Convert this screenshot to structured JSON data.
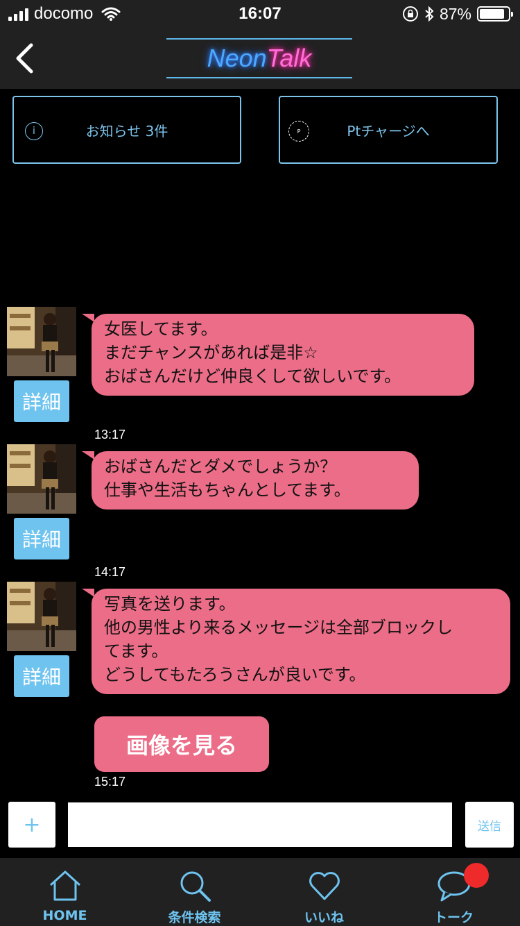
{
  "status_bar": {
    "carrier": "docomo",
    "time": "16:07",
    "battery": "87%",
    "battery_level": 0.87
  },
  "nav": {
    "logo_part1": "Neon",
    "logo_part2": "Talk"
  },
  "info": {
    "notices_label": "お知らせ 3件",
    "charge_label": "Ptチャージへ",
    "charge_icon": "P"
  },
  "messages": [
    {
      "lines": [
        "女医してます。",
        "まだチャンスがあれば是非☆",
        "おばさんだけど仲良くして欲しいです。"
      ],
      "time": "13:17",
      "detail_label": "詳細"
    },
    {
      "lines": [
        "おばさんだとダメでしょうか？",
        "仕事や生活もちゃんとしてます。"
      ],
      "time": "14:17",
      "detail_label": "詳細"
    },
    {
      "lines": [
        "写真を送ります。",
        "他の男性より来るメッセージは全部ブロックし",
        "てます。",
        "どうしてもたろうさんが良いです。"
      ],
      "time": "15:17",
      "detail_label": "詳細"
    }
  ],
  "view_image_label": "画像を見る",
  "composer": {
    "plus_label": "+",
    "send_label": "送信",
    "input_value": ""
  },
  "tabs": [
    {
      "label": "HOME",
      "icon": "home-icon"
    },
    {
      "label": "条件検索",
      "icon": "search-icon"
    },
    {
      "label": "いいね",
      "icon": "heart-icon"
    },
    {
      "label": "トーク",
      "icon": "chat-icon"
    }
  ],
  "colors": {
    "bubble": "#ec6d88",
    "accent": "#6ec3ef",
    "badge": "#ef2a2a"
  }
}
